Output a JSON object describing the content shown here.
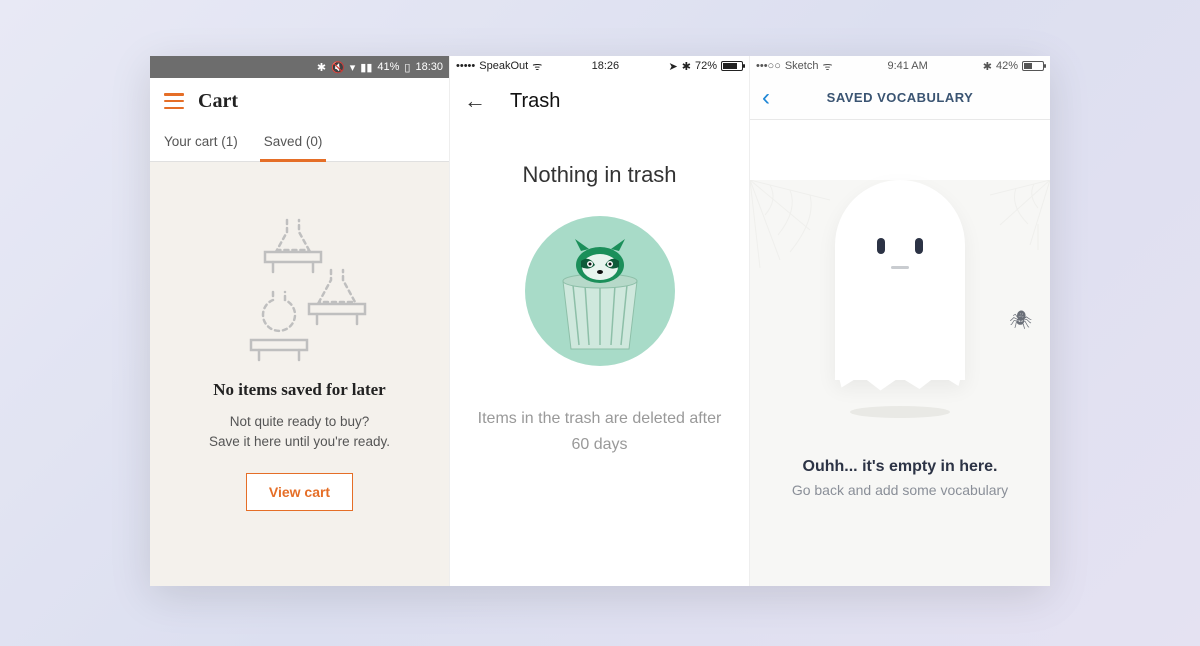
{
  "phone1": {
    "status": {
      "signal": "41%",
      "time": "18:30"
    },
    "title": "Cart",
    "tabs": [
      {
        "label": "Your cart (1)",
        "active": false
      },
      {
        "label": "Saved (0)",
        "active": true
      }
    ],
    "headline": "No items saved for later",
    "sub1": "Not quite ready to buy?",
    "sub2": "Save it here until you're ready.",
    "button": "View cart"
  },
  "phone2": {
    "status": {
      "carrier": "SpeakOut",
      "time": "18:26",
      "battery": "72%"
    },
    "title": "Trash",
    "headline": "Nothing in trash",
    "sub": "Items in the trash are deleted after 60 days"
  },
  "phone3": {
    "status": {
      "carrier": "Sketch",
      "time": "9:41 AM",
      "battery": "42%"
    },
    "title": "SAVED VOCABULARY",
    "headline": "Ouhh... it's empty in here.",
    "sub": "Go back and add some vocabulary"
  }
}
